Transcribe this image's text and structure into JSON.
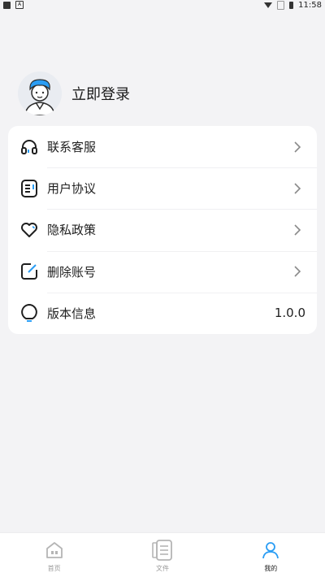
{
  "status_bar": {
    "time": "11:58"
  },
  "profile": {
    "login_label": "立即登录"
  },
  "menu": [
    {
      "label": "联系客服",
      "icon": "headset-icon",
      "has_chevron": true
    },
    {
      "label": "用户协议",
      "icon": "document-icon",
      "has_chevron": true
    },
    {
      "label": "隐私政策",
      "icon": "heart-icon",
      "has_chevron": true
    },
    {
      "label": "删除账号",
      "icon": "edit-icon",
      "has_chevron": true
    },
    {
      "label": "版本信息",
      "icon": "bulb-icon",
      "value": "1.0.0"
    }
  ],
  "bottom_nav": [
    {
      "label": "首页",
      "icon": "home-icon"
    },
    {
      "label": "文件",
      "icon": "files-icon"
    },
    {
      "label": "我的",
      "icon": "profile-icon",
      "active": true
    }
  ],
  "colors": {
    "accent": "#2a9df4",
    "background": "#f3f3f5"
  }
}
